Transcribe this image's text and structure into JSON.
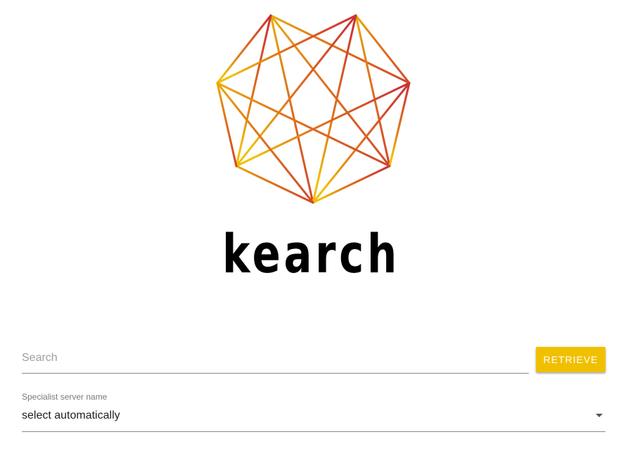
{
  "brand": {
    "wordmark": "kearch",
    "logo_icon": "heptagram-icon",
    "gradient_colors": [
      "#f0c000",
      "#cc3333"
    ]
  },
  "search": {
    "placeholder": "Search",
    "value": ""
  },
  "retrieve_button": {
    "label": "RETRIEVE",
    "color": "#f0c000"
  },
  "specialist_select": {
    "label": "Specialist server name",
    "selected": "select automatically",
    "caret_icon": "caret-down-icon"
  }
}
